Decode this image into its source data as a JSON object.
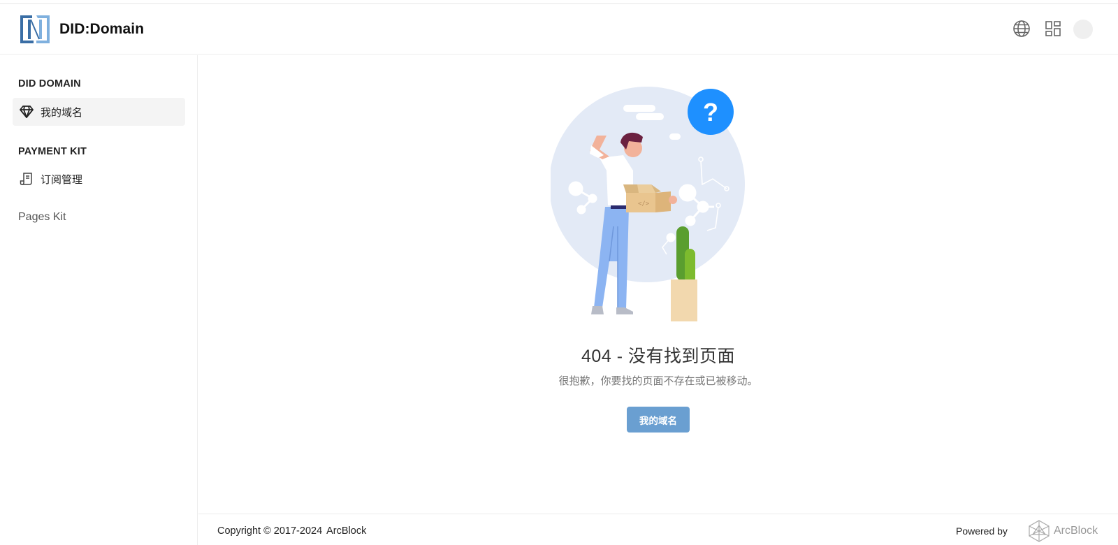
{
  "app": {
    "title": "DID:Domain"
  },
  "sidebar": {
    "sections": [
      {
        "title": "DID DOMAIN",
        "items": [
          {
            "label": "我的域名",
            "icon": "gem-icon",
            "active": true
          }
        ]
      },
      {
        "title": "PAYMENT KIT",
        "items": [
          {
            "label": "订阅管理",
            "icon": "receipt-icon",
            "active": false
          }
        ]
      }
    ],
    "extra_link": "Pages Kit"
  },
  "header": {
    "icons": [
      "globe-icon",
      "apps-grid-icon",
      "avatar"
    ]
  },
  "error": {
    "title": "404 - 没有找到页面",
    "description": "很抱歉，你要找的页面不存在或已被移动。",
    "button_label": "我的域名"
  },
  "footer": {
    "copyright": "Copyright © 2017-2024",
    "company": "ArcBlock",
    "powered_by": "Powered by",
    "powered_brand": "ArcBlock"
  },
  "colors": {
    "primary_button": "#6a9fd1",
    "question_badge": "#1e90ff",
    "illustration_circle": "#e3eaf6"
  }
}
